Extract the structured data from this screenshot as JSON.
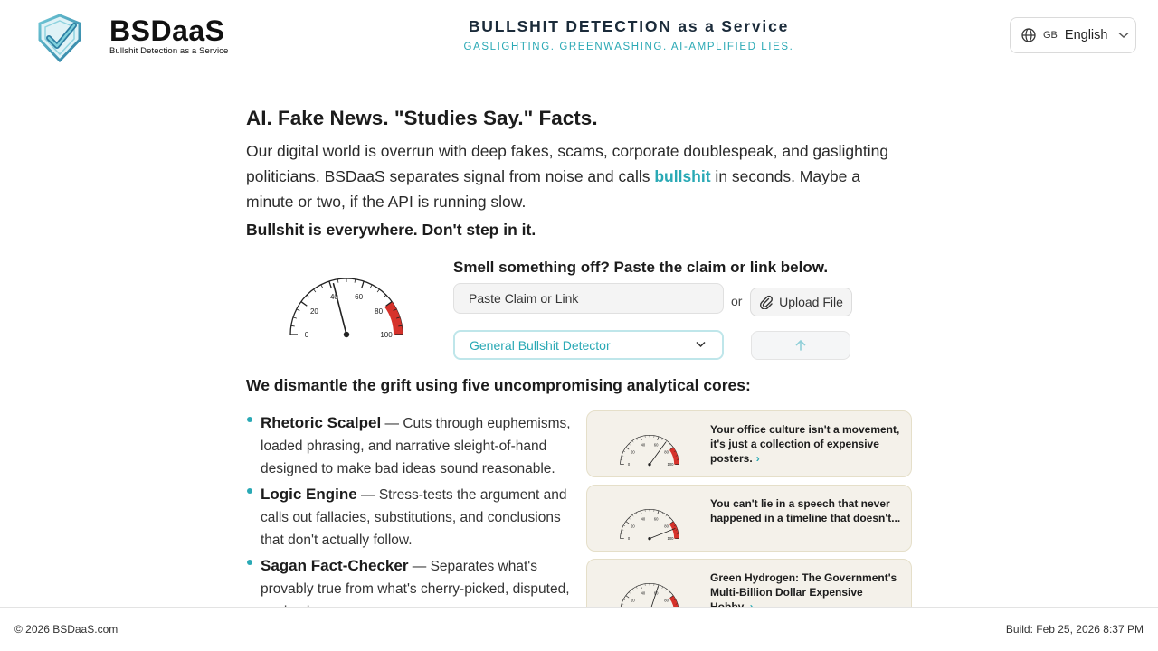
{
  "header": {
    "brand_name": "BSDaaS",
    "brand_sub": "Bullshit Detection as a Service",
    "hero_title": "BULLSHIT DETECTION as a Service",
    "hero_tagline": "GASLIGHTING. GREENWASHING. AI-AMPLIFIED LIES.",
    "language": {
      "code": "GB",
      "label": "English"
    }
  },
  "main": {
    "heading": "AI. Fake News. \"Studies Say.\" Facts.",
    "intro_before": "Our digital world is overrun with deep fakes, scams, corporate doublespeak, and gaslighting politicians. BSDaaS separates signal from noise and calls ",
    "intro_highlight": "bullshit",
    "intro_after": " in seconds. Maybe a minute or two, if the API is running slow.",
    "tagline": "Bullshit is everywhere. Don't step in it."
  },
  "gauge": {
    "tick_labels": [
      "0",
      "20",
      "40",
      "60",
      "80",
      "100"
    ],
    "value": 42
  },
  "form": {
    "title": "Smell something off? Paste the claim or link below.",
    "input_placeholder": "Paste Claim or Link",
    "or_label": "or",
    "upload_label": "Upload File",
    "detector_selected": "General Bullshit Detector"
  },
  "cores": {
    "title": "We dismantle the grift using five uncompromising analytical cores:",
    "items": [
      {
        "name": "Rhetoric Scalpel",
        "desc": " — Cuts through euphemisms, loaded phrasing, and narrative sleight-of-hand designed to make bad ideas sound reasonable."
      },
      {
        "name": "Logic Engine",
        "desc": " — Stress-tests the argument and calls out fallacies, substitutions, and conclusions that don't actually follow."
      },
      {
        "name": "Sagan Fact-Checker",
        "desc": " — Separates what's provably true from what's cherry-picked, disputed, or simply wrong."
      }
    ]
  },
  "examples": [
    {
      "text": "Your office culture isn't a movement, it's just a collection of expensive posters.",
      "score": 70
    },
    {
      "text": "You can't lie in a speech that never happened in a timeline that doesn't...",
      "score": 88
    },
    {
      "text": "Green Hydrogen: The Government's Multi-Billion Dollar Expensive Hobby.",
      "score": 60
    }
  ],
  "footer": {
    "copyright": "© 2026 BSDaaS.com",
    "build": "Build: Feb 25, 2026 8:37 PM"
  },
  "colors": {
    "accent": "#2aa9b5",
    "danger": "#d6322b",
    "card_bg": "#f4f1ea"
  }
}
